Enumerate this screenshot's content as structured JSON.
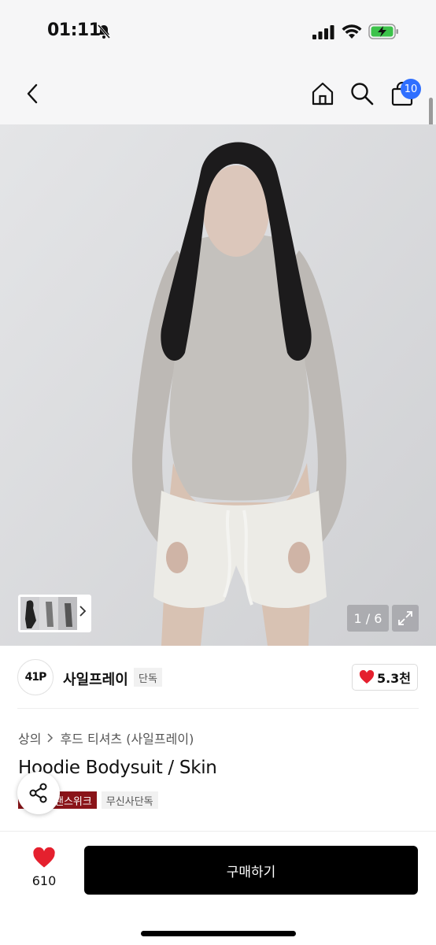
{
  "status_bar": {
    "time": "01:11",
    "icons": [
      "bell-off-icon",
      "signal-icon",
      "wifi-icon",
      "battery-charging-icon"
    ]
  },
  "header": {
    "icons": [
      "back-icon",
      "home-icon",
      "search-icon",
      "cart-icon"
    ],
    "cart_count": "10"
  },
  "gallery": {
    "counter": "1 / 6"
  },
  "brand": {
    "logo_text": "41P",
    "name": "사일프레이",
    "tag": "단독",
    "likes": "5.3천"
  },
  "breadcrumb": {
    "items": [
      "상의",
      "후드 티셔츠 (사일프레이)"
    ]
  },
  "product": {
    "title": "Hoodie Bodysuit / Skin",
    "badges": [
      "브랜드스위크",
      "무신사단독"
    ],
    "badge_visible": [
      "랜스위크",
      "무신사단독"
    ]
  },
  "bottom_bar": {
    "wish_count": "610",
    "buy_label": "구매하기"
  },
  "colors": {
    "accent_blue": "#2f6fff",
    "badge_red": "#8a1419",
    "heart_red": "#e5202e",
    "button_black": "#000000"
  }
}
